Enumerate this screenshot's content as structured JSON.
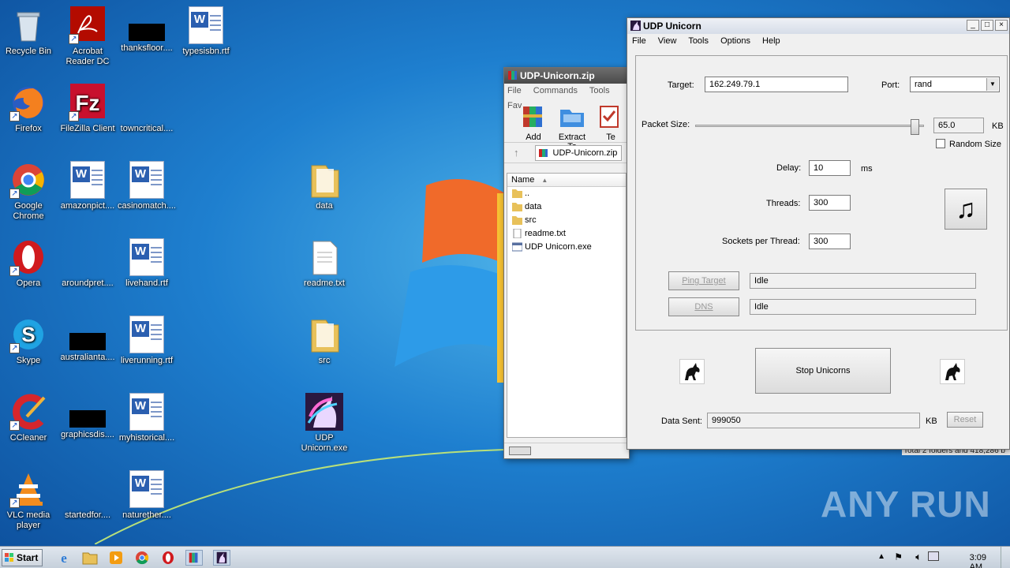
{
  "desktop": {
    "icons": [
      {
        "label": "Recycle Bin"
      },
      {
        "label": "Acrobat Reader DC"
      },
      {
        "label": "thanksfloor...."
      },
      {
        "label": "typesisbn.rtf"
      },
      {
        "label": "Firefox"
      },
      {
        "label": "FileZilla Client"
      },
      {
        "label": "towncritical...."
      },
      {
        "label": "Google Chrome"
      },
      {
        "label": "amazonpict...."
      },
      {
        "label": "casinomatch...."
      },
      {
        "label": "data"
      },
      {
        "label": "Opera"
      },
      {
        "label": "aroundpret...."
      },
      {
        "label": "livehand.rtf"
      },
      {
        "label": "readme.txt"
      },
      {
        "label": "Skype"
      },
      {
        "label": "australianta...."
      },
      {
        "label": "liverunning.rtf"
      },
      {
        "label": "src"
      },
      {
        "label": "CCleaner"
      },
      {
        "label": "graphicsdis...."
      },
      {
        "label": "myhistorical...."
      },
      {
        "label": "UDP Unicorn.exe"
      },
      {
        "label": "VLC media player"
      },
      {
        "label": "startedfor...."
      },
      {
        "label": "naturether...."
      }
    ],
    "watermark": "ANY RUN"
  },
  "winrar": {
    "title": "UDP-Unicorn.zip",
    "menu": [
      "File",
      "Commands",
      "Tools",
      "Fav"
    ],
    "toolbar": [
      {
        "label": "Add"
      },
      {
        "label": "Extract To"
      },
      {
        "label": "Te"
      }
    ],
    "path": "UDP-Unicorn.zip",
    "column_name": "Name",
    "files": [
      "..",
      "data",
      "src",
      "readme.txt",
      "UDP Unicorn.exe"
    ],
    "status": "Total 2 folders and 418,286 b"
  },
  "udp": {
    "title": "UDP Unicorn",
    "menu": [
      "File",
      "View",
      "Tools",
      "Options",
      "Help"
    ],
    "target_label": "Target:",
    "target_value": "162.249.79.1",
    "port_label": "Port:",
    "port_value": "rand",
    "packet_size_label": "Packet Size:",
    "packet_size_value": "65.0",
    "packet_size_unit": "KB",
    "packet_size_fraction": 0.98,
    "random_size_label": "Random Size",
    "delay_label": "Delay:",
    "delay_value": "10",
    "delay_unit": "ms",
    "threads_label": "Threads:",
    "threads_value": "300",
    "sockets_label": "Sockets per Thread:",
    "sockets_value": "300",
    "ping_button": "Ping Target",
    "ping_status": "Idle",
    "dns_button": "DNS",
    "dns_status": "Idle",
    "stop_button": "Stop Unicorns",
    "data_sent_label": "Data Sent:",
    "data_sent_value": "999050",
    "data_sent_unit": "KB",
    "reset_button": "Reset"
  },
  "taskbar": {
    "start_label": "Start",
    "clock": "3:09 AM"
  }
}
